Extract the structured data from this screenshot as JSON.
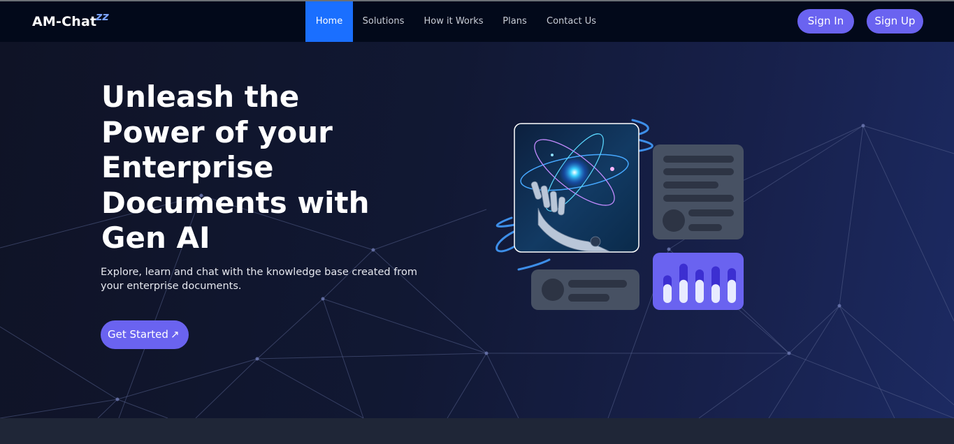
{
  "brand": {
    "name": "AM-Chat",
    "mark": "zz"
  },
  "nav": {
    "links": [
      {
        "label": "Home",
        "active": true
      },
      {
        "label": "Solutions",
        "active": false
      },
      {
        "label": "How it Works",
        "active": false
      },
      {
        "label": "Plans",
        "active": false
      },
      {
        "label": "Contact Us",
        "active": false
      }
    ],
    "sign_in": "Sign In",
    "sign_up": "Sign Up"
  },
  "hero": {
    "headline": "Unleash the Power of your Enterprise Documents with Gen AI",
    "subtext": "Explore, learn and chat with the knowledge base created from your enterprise documents.",
    "cta_label": "Get Started",
    "cta_icon": "arrow-up-right-icon"
  },
  "colors": {
    "accent": "#6a63f0",
    "nav_active": "#1a6fff",
    "nav_bg": "#02091a",
    "card_gray": "#475163"
  },
  "illustration": {
    "image_icon": "robot-hand-atom-icon",
    "chart_icon": "bar-chart-icon",
    "bars": [
      0.62,
      0.88,
      0.75,
      0.82,
      0.78
    ],
    "levels": [
      0.42,
      0.52,
      0.52,
      0.42,
      0.52
    ]
  }
}
